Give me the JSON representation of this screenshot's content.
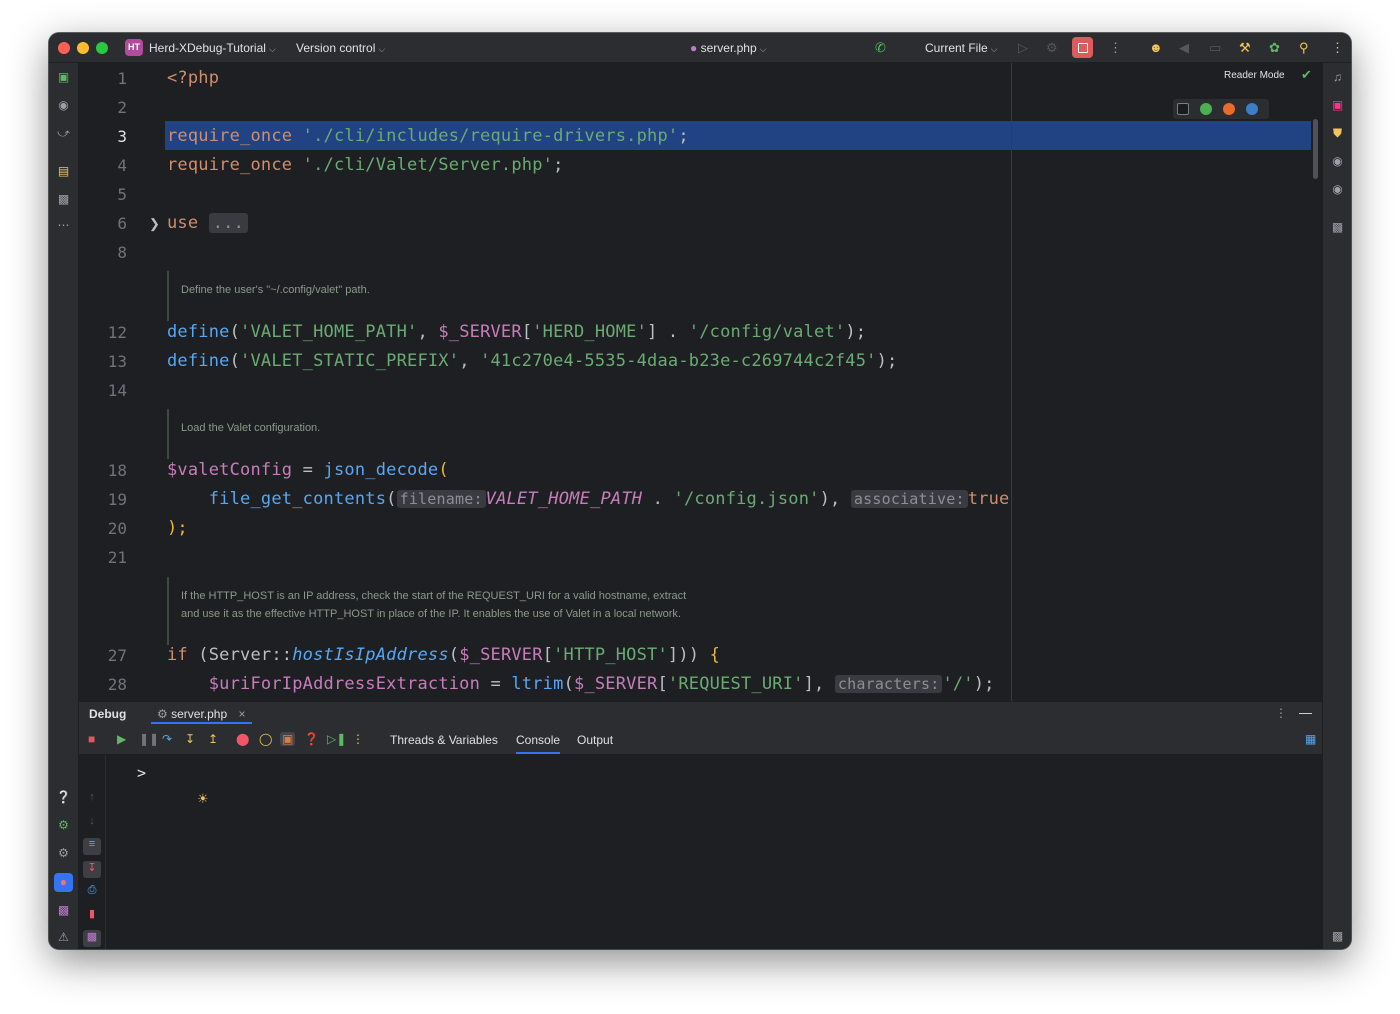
{
  "titlebar": {
    "project_badge": "HT",
    "project_name": "Herd-XDebug-Tutorial",
    "vcs": "Version control",
    "file": "server.php",
    "run_config": "Current File"
  },
  "editor": {
    "reader_mode": "Reader Mode",
    "lines": [
      {
        "n": "1"
      },
      {
        "n": "2"
      },
      {
        "n": "3"
      },
      {
        "n": "4"
      },
      {
        "n": "5"
      },
      {
        "n": "6"
      },
      {
        "n": "8"
      },
      {
        "n": "12"
      },
      {
        "n": "13"
      },
      {
        "n": "14"
      },
      {
        "n": "18"
      },
      {
        "n": "19"
      },
      {
        "n": "20"
      },
      {
        "n": "21"
      },
      {
        "n": "27"
      },
      {
        "n": "28"
      }
    ],
    "code": {
      "l1": "<?php",
      "l3_kw": "require_once",
      "l3_str": "'./cli/includes/require-drivers.php'",
      "l4_kw": "require_once",
      "l4_str": "'./cli/Valet/Server.php'",
      "l6_kw": "use",
      "l6_fold": "...",
      "doc1": "Define the user's \"~/.config/valet\" path.",
      "l12_fn": "define",
      "l12_s1": "'VALET_HOME_PATH'",
      "l12_var": "$_SERVER",
      "l12_s2": "'HERD_HOME'",
      "l12_s3": "'/config/valet'",
      "l13_fn": "define",
      "l13_s1": "'VALET_STATIC_PREFIX'",
      "l13_s2": "'41c270e4-5535-4daa-b23e-c269744c2f45'",
      "doc2": "Load the Valet configuration.",
      "l18_var": "$valetConfig",
      "l18_fn": "json_decode",
      "l19_fn": "file_get_contents",
      "l19_hint1": "filename:",
      "l19_const": "VALET_HOME_PATH",
      "l19_str": "'/config.json'",
      "l19_hint2": "associative:",
      "l19_true": "true",
      "l20": ");",
      "doc3a": "If the HTTP_HOST is an IP address, check the start of the REQUEST_URI for a valid hostname, extract",
      "doc3b": "and use it as the effective HTTP_HOST in place of the IP. It enables the use of Valet in a local network.",
      "l27_kw": "if",
      "l27_cls": "Server",
      "l27_method": "hostIsIpAddress",
      "l27_var": "$_SERVER",
      "l27_str": "'HTTP_HOST'",
      "l28_var": "$uriForIpAddressExtraction",
      "l28_fn": "ltrim",
      "l28_var2": "$_SERVER",
      "l28_str": "'REQUEST_URI'",
      "l28_hint": "characters:",
      "l28_str2": "'/'"
    }
  },
  "debug": {
    "title": "Debug",
    "session_tab": "server.php",
    "tabs": [
      "Threads & Variables",
      "Console",
      "Output"
    ],
    "active_tab": "Console",
    "prompt": ">"
  },
  "colors": {
    "accent": "#3574f0",
    "selection": "#214283",
    "stop_red": "#db5c5c"
  }
}
